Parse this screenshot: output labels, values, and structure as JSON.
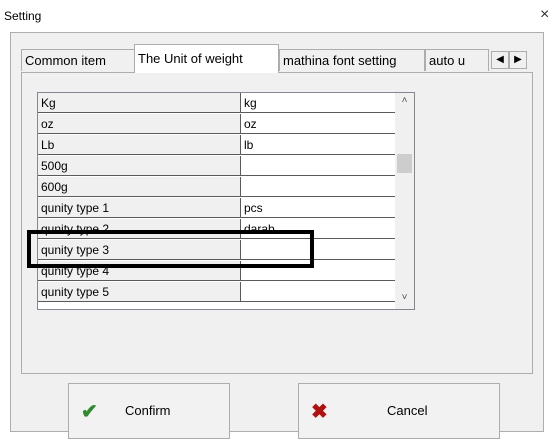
{
  "window": {
    "title": "Setting",
    "close_glyph": "×"
  },
  "tabs": [
    {
      "label": "Common item"
    },
    {
      "label": "The Unit of weight"
    },
    {
      "label": "mathina font setting"
    },
    {
      "label": "auto u"
    }
  ],
  "tab_scroll": {
    "left_glyph": "◀",
    "right_glyph": "▶"
  },
  "grid": {
    "rows": [
      {
        "name": "Kg",
        "value": "kg"
      },
      {
        "name": "oz",
        "value": "oz"
      },
      {
        "name": "Lb",
        "value": "lb"
      },
      {
        "name": "500g",
        "value": ""
      },
      {
        "name": "600g",
        "value": ""
      },
      {
        "name": "qunity type 1",
        "value": "pcs"
      },
      {
        "name": "qunity type 2",
        "value": "darab"
      },
      {
        "name": "qunity type 3",
        "value": ""
      },
      {
        "name": "qunity type 4",
        "value": ""
      },
      {
        "name": "qunity type 5",
        "value": ""
      }
    ],
    "scroll_up_glyph": "˄",
    "scroll_down_glyph": "˅"
  },
  "buttons": {
    "confirm": {
      "label": "Confirm",
      "icon": "check-icon",
      "glyph": "✔",
      "color": "#2e8b2e"
    },
    "cancel": {
      "label": "Cancel",
      "icon": "cross-icon",
      "glyph": "✖",
      "color": "#b01010"
    }
  },
  "colors": {
    "highlight_box": "#000000",
    "dialog_bg": "#f0f0f0"
  }
}
